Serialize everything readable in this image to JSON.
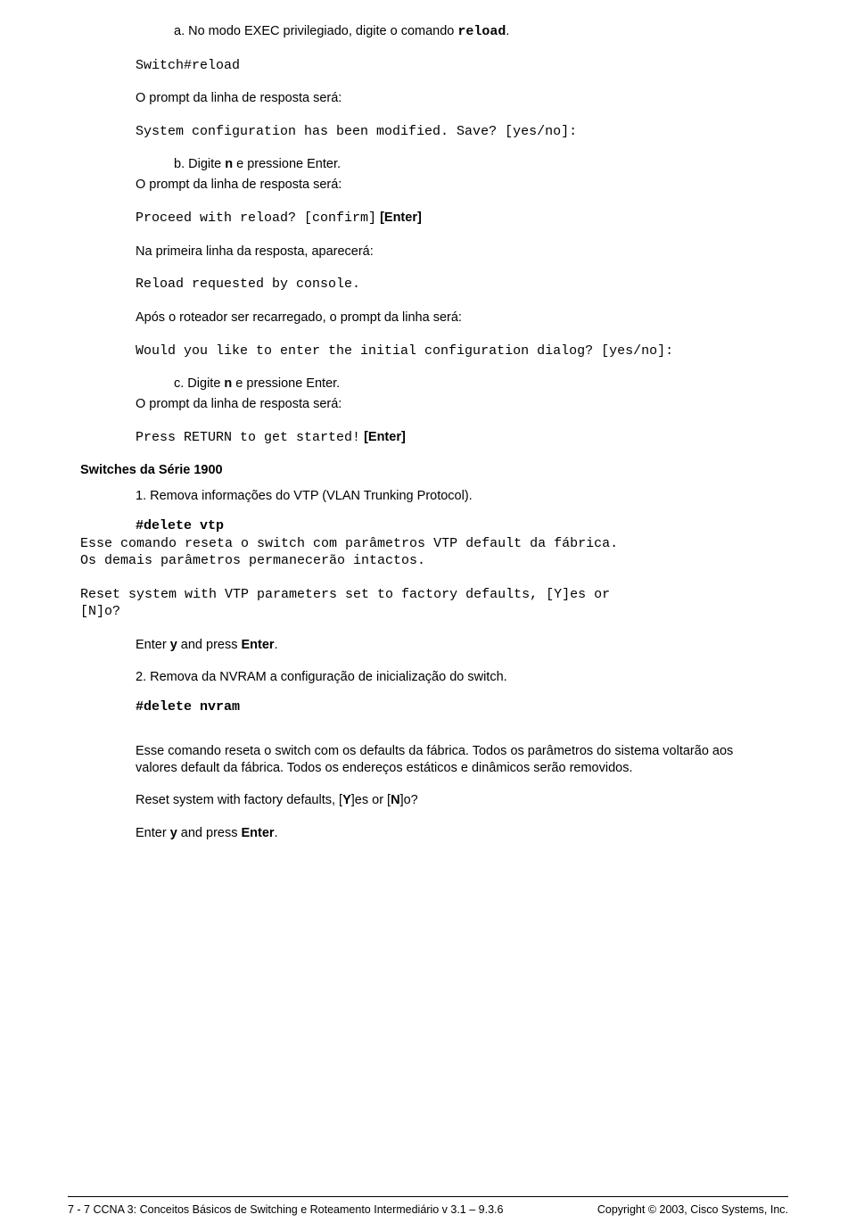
{
  "p1_label": "a.   No modo EXEC privilegiado, digite o comando ",
  "p1_code": "reload",
  "p1_dot": ".",
  "p2": "Switch#reload",
  "p3": "O prompt da linha de resposta será:",
  "p4": "System configuration has been modified. Save? [yes/no]:",
  "p5_label": "b.   Digite ",
  "p5_n": "n",
  "p5_rest": " e pressione Enter.",
  "p6": "O prompt da linha de resposta será:",
  "p7_a": "Proceed with reload? [confirm]",
  "p7_b": " [Enter]",
  "p8": "Na primeira linha da resposta, aparecerá:",
  "p9": "Reload requested by console.",
  "p10": "Após o roteador ser recarregado, o prompt da linha será:",
  "p11": "Would you like to enter the initial configuration dialog? [yes/no]:",
  "p12_label": "c.   Digite ",
  "p12_n": "n",
  "p12_rest": " e pressione Enter.",
  "p13": "O prompt da linha de resposta será:",
  "p14_a": "Press RETURN to get started!",
  "p14_b": " [Enter]",
  "sec_title": "Switches da Série 1900",
  "li1": "1.  Remova informações do VTP (VLAN Trunking Protocol).",
  "cmd1": "#delete vtp",
  "c1l1": "Esse comando reseta o switch com parâmetros VTP default da fábrica.",
  "c1l2": "Os demais parâmetros permanecerão intactos.",
  "c1l3a": "Reset system with VTP parameters set to factory defaults, [Y]es or",
  "c1l3b": "[N]o?",
  "enter1a": "Enter ",
  "enter1b": "y",
  "enter1c": " and press ",
  "enter1d": "Enter",
  "enter1e": ".",
  "li2": "2.  Remova da NVRAM a configuração de inicialização do switch.",
  "cmd2": "#delete nvram",
  "desc2": "Esse comando reseta o switch com os defaults da fábrica. Todos os parâmetros do sistema voltarão aos valores default da fábrica. Todos os endereços estáticos e dinâmicos serão removidos.",
  "reset2a": "Reset system with factory defaults, [",
  "reset2b": "Y",
  "reset2c": "]es or [",
  "reset2d": "N",
  "reset2e": "]o?",
  "footer_left": "7 - 7   CCNA 3: Conceitos Básicos de Switching e Roteamento Intermediário v 3.1 – 9.3.6",
  "footer_right": "Copyright © 2003, Cisco Systems, Inc."
}
